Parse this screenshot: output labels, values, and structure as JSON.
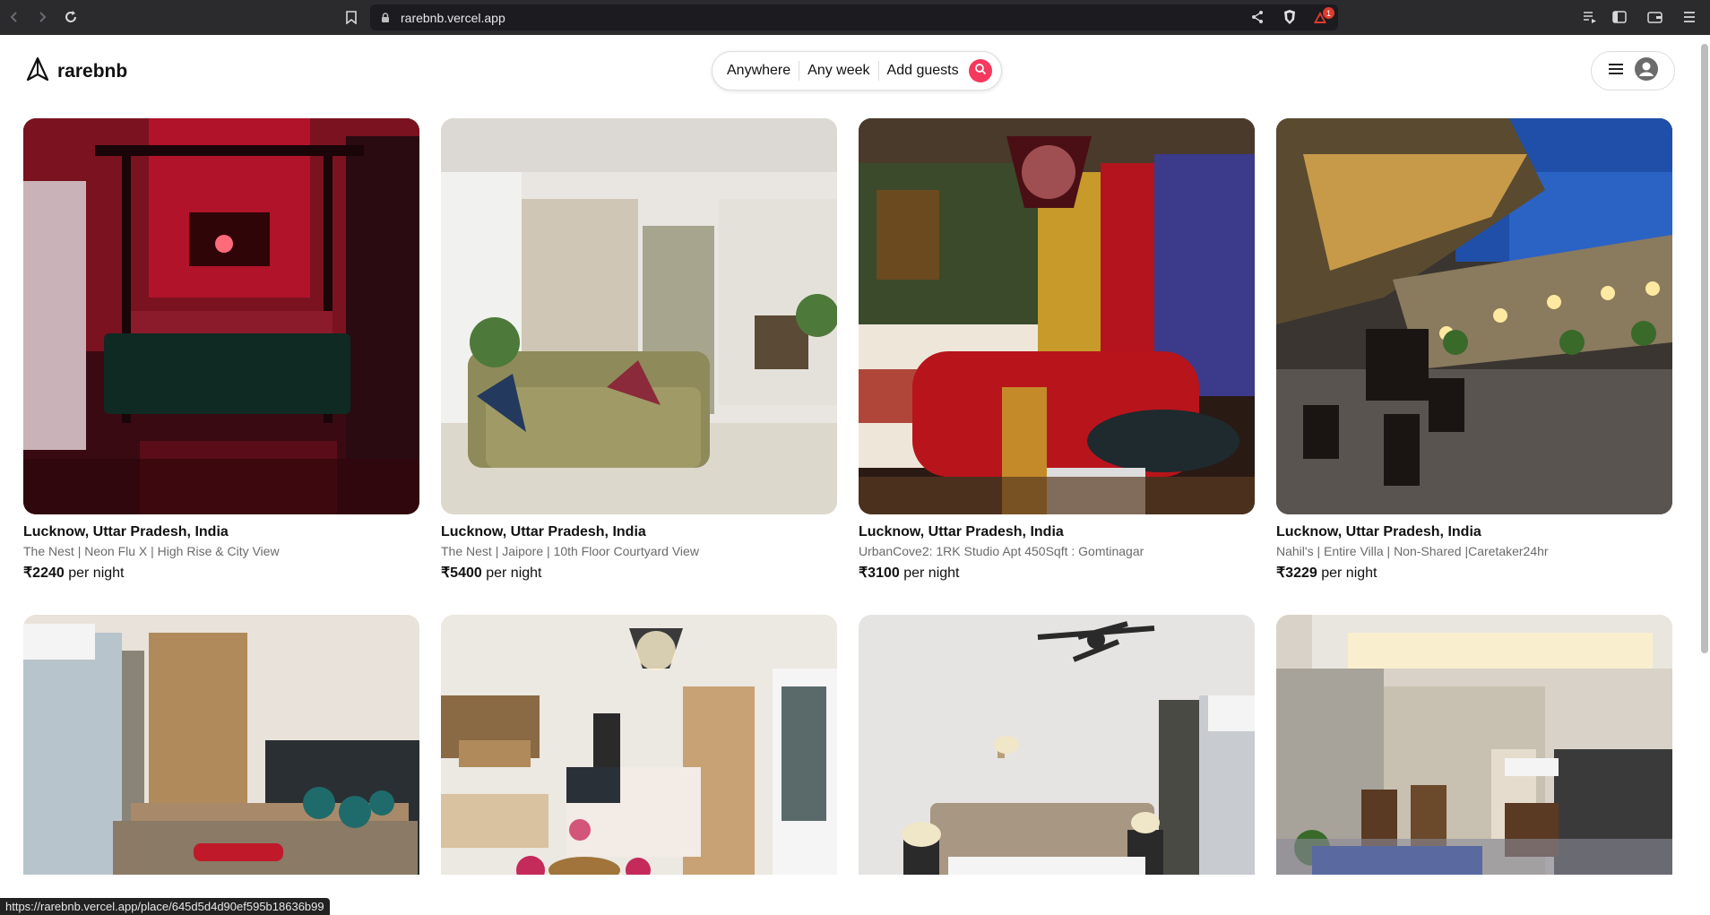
{
  "browser": {
    "url": "rarebnb.vercel.app",
    "brave_badge": "1"
  },
  "header": {
    "brand": "rarebnb",
    "search": {
      "where": "Anywhere",
      "when": "Any week",
      "who": "Add guests"
    }
  },
  "listings": [
    {
      "location": "Lucknow, Uttar Pradesh, India",
      "title": "The Nest | Neon Flu X | High Rise & City View",
      "price": "₹2240",
      "per": "per night"
    },
    {
      "location": "Lucknow, Uttar Pradesh, India",
      "title": "The Nest | Jaipore | 10th Floor Courtyard View",
      "price": "₹5400",
      "per": "per night"
    },
    {
      "location": "Lucknow, Uttar Pradesh, India",
      "title": "UrbanCove2: 1RK Studio Apt 450Sqft : Gomtinagar",
      "price": "₹3100",
      "per": "per night"
    },
    {
      "location": "Lucknow, Uttar Pradesh, India",
      "title": "Nahil's | Entire Villa | Non-Shared |Caretaker24hr",
      "price": "₹3229",
      "per": "per night"
    }
  ],
  "status_url": "https://rarebnb.vercel.app/place/645d5d4d90ef595b18636b99",
  "colors": {
    "accent": "#f5385d",
    "browser_chrome": "#2b2b2e"
  }
}
